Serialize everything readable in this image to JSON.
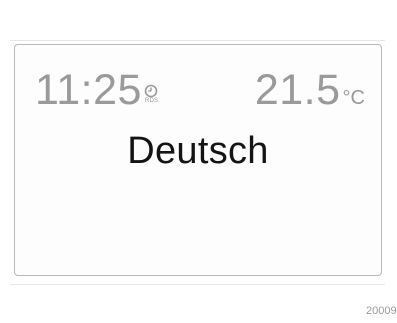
{
  "display": {
    "clock": {
      "time": "11:25",
      "icon": "clock-icon",
      "rds_label": "RDS"
    },
    "temperature": {
      "value": "21.5",
      "unit": "°C"
    },
    "language": "Deutsch"
  },
  "footer": {
    "image_ref": "20009"
  },
  "colors": {
    "status_text": "#9a9a9a",
    "main_text": "#141414",
    "frame_border": "#b8b8b8"
  }
}
